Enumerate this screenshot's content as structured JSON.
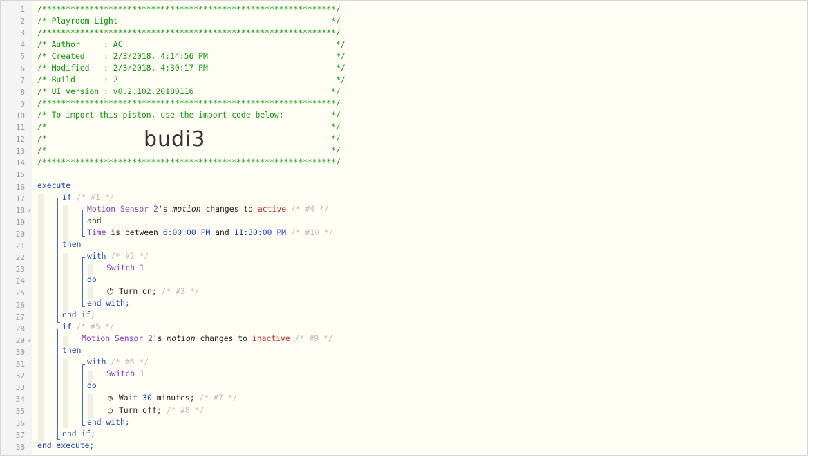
{
  "gutter": {
    "line_numbers": [
      "1",
      "2",
      "3",
      "4",
      "5",
      "6",
      "7",
      "8",
      "9",
      "10",
      "11",
      "12",
      "13",
      "14",
      "15",
      "16",
      "17",
      "18",
      "19",
      "20",
      "21",
      "22",
      "23",
      "24",
      "25",
      "26",
      "27",
      "28",
      "29",
      "30",
      "31",
      "32",
      "33",
      "34",
      "35",
      "36",
      "37",
      "38"
    ],
    "trigger_icon": "⚡"
  },
  "header": {
    "stars": "/**************************************************************/",
    "title": "/* Playroom Light                                             */",
    "author": "/* Author     : AC                                             */",
    "created": "/* Created    : 2/3/2018, 4:14:56 PM                           */",
    "modified": "/* Modified   : 2/3/2018, 4:30:17 PM                           */",
    "build": "/* Build      : 2                                              */",
    "ui_version": "/* UI version : v0.2.102.20180116                             */",
    "import_note": "/* To import this piston, use the import code below:          */",
    "blank": "/*                                                            */",
    "import_code": "budi3"
  },
  "code": {
    "execute": "execute",
    "if": "if",
    "then": "then",
    "and": "and",
    "with": "with",
    "do": "do",
    "end_with": "end with;",
    "end_if": "end if;",
    "end_execute": "end execute;",
    "c1": "/* #1 */",
    "c2": "/* #2 */",
    "c3": "/* #3 */",
    "c4": "/* #4 */",
    "c5": "/* #5 */",
    "c6": "/* #6 */",
    "c7": "/* #7 */",
    "c8": "/* #8 */",
    "c9": "/* #9 */",
    "c10": "/* #10 */",
    "motion_sensor": "Motion Sensor 2",
    "possessive": "'s ",
    "motion": "motion",
    "changes_to": " changes to ",
    "active": "active",
    "inactive": "inactive",
    "time": "Time",
    "is_between": " is between ",
    "time_start": "6:00:00 PM",
    "and_mid": " and ",
    "time_end": "11:30:00 PM",
    "switch": "Switch 1",
    "turn_on": "Turn on;",
    "wait": "Wait ",
    "wait_val": "30",
    "minutes": " minutes;",
    "turn_off": "Turn off;"
  },
  "icons": {
    "power": "⏻",
    "clock": "◷",
    "circle": "○"
  },
  "colors": {
    "comment": "#0a9a0a",
    "keyword": "#1a48cc",
    "device": "#8a3fc4",
    "value": "#d12b2b",
    "trigger": "#f08a2c"
  }
}
